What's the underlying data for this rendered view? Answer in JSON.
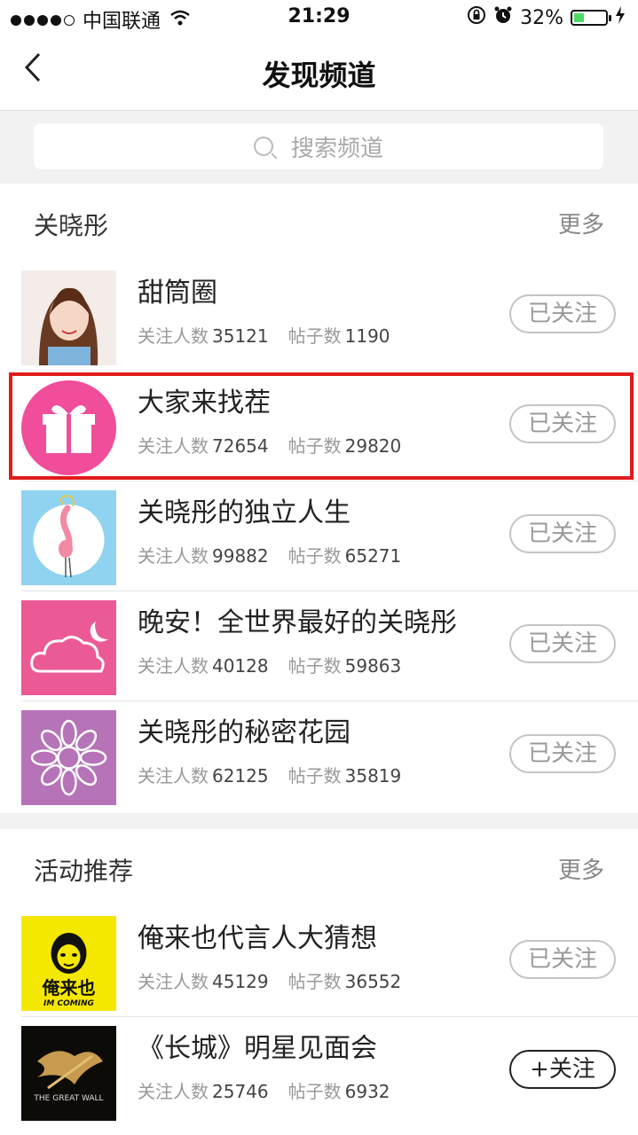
{
  "status_bar": {
    "carrier": "中国联通",
    "time": "21:29",
    "battery": "32%",
    "icons": [
      "signal-dots-icon",
      "wifi-icon",
      "orientation-lock-icon",
      "alarm-icon",
      "battery-icon",
      "charging-icon"
    ]
  },
  "nav": {
    "back_icon": "chevron-left-icon",
    "title": "发现频道"
  },
  "search": {
    "placeholder": "搜索频道",
    "icon": "search-icon"
  },
  "sections": [
    {
      "title": "关晓彤",
      "more": "更多",
      "items": [
        {
          "name": "甜筒圈",
          "followers_label": "关注人数",
          "followers": "35121",
          "posts_label": "帖子数",
          "posts": "1190",
          "button": "已关注",
          "thumb_icon": "portrait-photo"
        },
        {
          "name": "大家来找茬",
          "followers_label": "关注人数",
          "followers": "72654",
          "posts_label": "帖子数",
          "posts": "29820",
          "button": "已关注",
          "thumb_icon": "gift-icon",
          "highlighted": true
        },
        {
          "name": "关晓彤的独立人生",
          "followers_label": "关注人数",
          "followers": "99882",
          "posts_label": "帖子数",
          "posts": "65271",
          "button": "已关注",
          "thumb_icon": "flamingo-icon"
        },
        {
          "name": "晚安！全世界最好的关晓彤",
          "followers_label": "关注人数",
          "followers": "40128",
          "posts_label": "帖子数",
          "posts": "59863",
          "button": "已关注",
          "thumb_icon": "cloud-moon-icon"
        },
        {
          "name": "关晓彤的秘密花园",
          "followers_label": "关注人数",
          "followers": "62125",
          "posts_label": "帖子数",
          "posts": "35819",
          "button": "已关注",
          "thumb_icon": "flower-icon"
        }
      ]
    },
    {
      "title": "活动推荐",
      "more": "更多",
      "items": [
        {
          "name": "俺来也代言人大猜想",
          "followers_label": "关注人数",
          "followers": "45129",
          "posts_label": "帖子数",
          "posts": "36552",
          "button": "已关注",
          "thumb_icon": "im-coming-logo",
          "logo_text": "俺来也",
          "logo_sub": "IM COMING"
        },
        {
          "name": "《长城》明星见面会",
          "followers_label": "关注人数",
          "followers": "25746",
          "posts_label": "帖子数",
          "posts": "6932",
          "button": "+关注",
          "thumb_icon": "great-wall-logo",
          "logo_text": "THE GREAT WALL"
        }
      ]
    }
  ],
  "colors": {
    "highlight": "#e01b1b",
    "gift_bg": "#f04d9b",
    "flamingo_bg": "#8fd3f0",
    "cloud_bg": "#ec5a95",
    "flower_bg": "#b673b8",
    "imcoming_bg": "#f5e800",
    "battery_fill": "#4cd964"
  }
}
